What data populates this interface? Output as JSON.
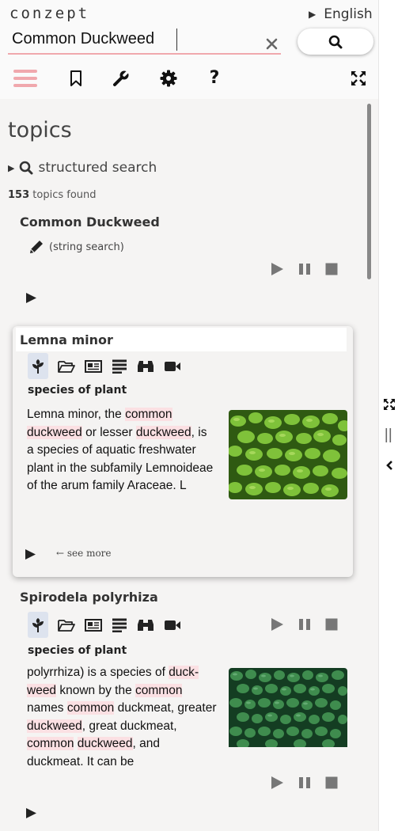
{
  "app": {
    "logo": "conzept",
    "language": "English"
  },
  "search": {
    "value": "Common Duckweed",
    "clear_icon": "✕"
  },
  "toolbar": {
    "items": [
      "menu-icon",
      "bookmark-icon",
      "wrench-icon",
      "gear-icon",
      "help-icon",
      "expand-icon"
    ],
    "help_label": "?"
  },
  "accent_color": "#f0a8ad",
  "topics": {
    "heading": "topics",
    "structured_search": "structured search",
    "found_count": "153",
    "found_suffix": " topics found"
  },
  "query_item": {
    "title": "Common Duckweed",
    "sub": "(string search)"
  },
  "results": [
    {
      "title": "Lemna minor",
      "type": "species of plant",
      "description_parts": [
        {
          "t": "Lemna minor, the ",
          "h": false
        },
        {
          "t": "common",
          "h": true
        },
        {
          "t": " ",
          "h": false
        },
        {
          "t": "duckweed",
          "h": true
        },
        {
          "t": " or lesser ",
          "h": false
        },
        {
          "t": "duckweed",
          "h": true
        },
        {
          "t": ", is a species of aquatic freshwa­ter plant in the subfamily Lemnoideae of the arum family Araceae. L",
          "h": false
        }
      ],
      "see_more": "see more"
    },
    {
      "title": "Spirodela polyrhiza",
      "type": "species of plant",
      "description_parts": [
        {
          "t": "polyrrhiza) is a species of ",
          "h": false
        },
        {
          "t": "duck­weed",
          "h": true
        },
        {
          "t": " known by the ",
          "h": false
        },
        {
          "t": "common",
          "h": true
        },
        {
          "t": " names ",
          "h": false
        },
        {
          "t": "common",
          "h": true
        },
        {
          "t": " duckmeat, greater ",
          "h": false
        },
        {
          "t": "duckweed",
          "h": true
        },
        {
          "t": ", great duck­meat, ",
          "h": false
        },
        {
          "t": "common",
          "h": true
        },
        {
          "t": " ",
          "h": false
        },
        {
          "t": "duckweed",
          "h": true
        },
        {
          "t": ", and duckmeat. It can be",
          "h": false
        }
      ]
    }
  ]
}
